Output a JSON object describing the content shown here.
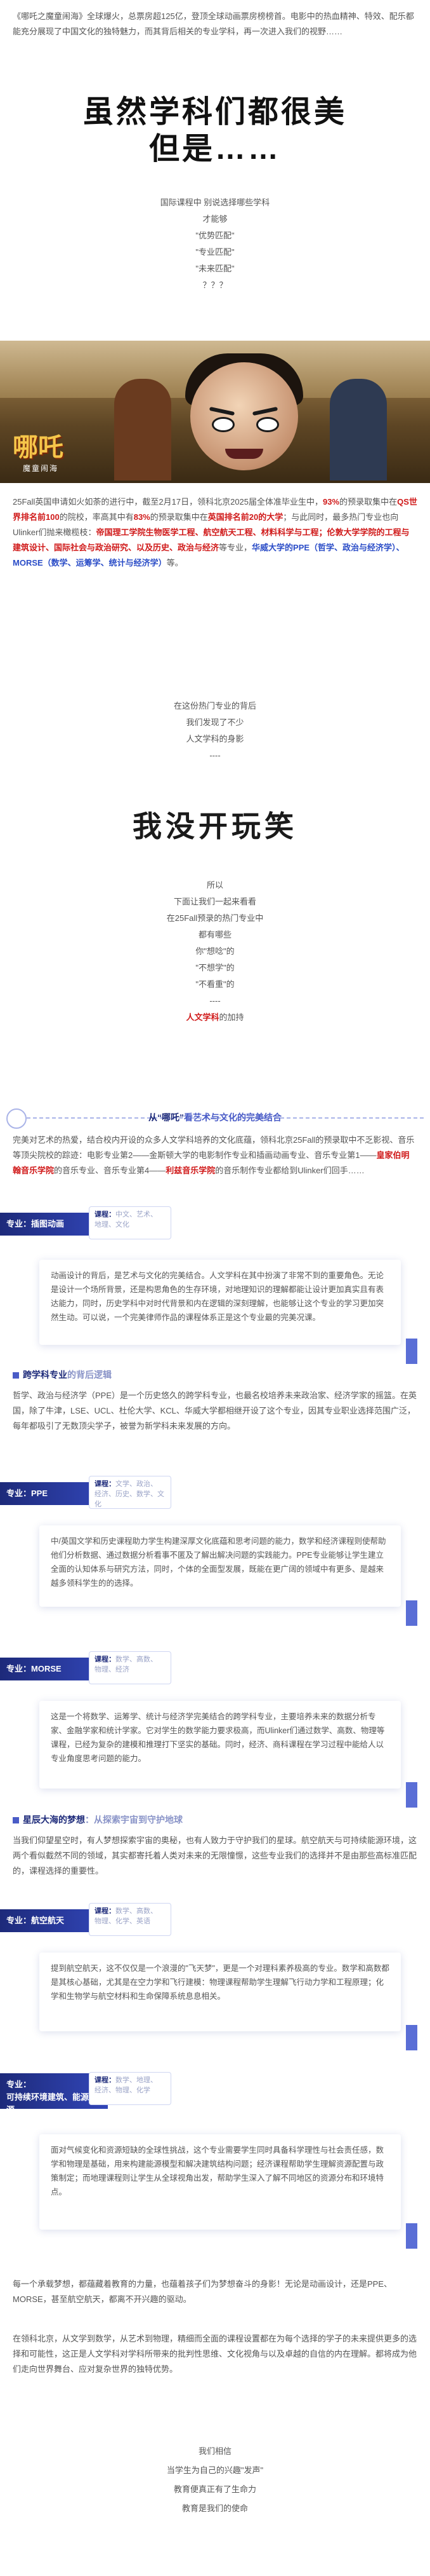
{
  "intro": {
    "line": "《哪吒之魔童闹海》全球爆火，总票房超125亿，登顶全球动画票房榜榜首。电影中的热血精神、特效、配乐都能充分展现了中国文化的独特魅力，而其背后相关的专业学科，再一次进入我们的视野……"
  },
  "hero": {
    "line1": "虽然学科们都很美",
    "line2": "但是……"
  },
  "pre_center": [
    "国际课程中 别说选择哪些学科",
    "才能够",
    "\"优势匹配\"",
    "\"专业匹配\"",
    "\"未来匹配\"",
    "？？？"
  ],
  "movie": {
    "logo": "哪吒",
    "logo_sub": "魔童闹海"
  },
  "fall": {
    "text_a": "25Fall英国申请如火如荼的进行中，截至2月17日，领科北京2025届全体准毕业生中，",
    "pct93": "93%",
    "text_b": "的预录取集中在",
    "qs100": "QS世界排名前100",
    "text_c": "的院校，率高其中有",
    "pct83": "83%",
    "text_d": "的预录取集中在",
    "uk_top20": "英国排名前20的大学",
    "text_e": "；与此同时，最多热门专业也向Ulinker们抛来橄榄枝：",
    "u1": "帝国理工学院生物医学工程、航空航天工程、材料科学与工程；伦敦大学学院的工程与建筑设计、国际社会与政治研究、以及历史、政治与经济",
    "text_f": "等专业，",
    "u2": "华威大学的PPE（哲学、政治与经济学）、MORSE（数学、运筹学、统计与经济学）",
    "text_g": "等。"
  },
  "mid_center": [
    "在这份热门专业的背后",
    "我们发现了不少",
    "人文学科的身影",
    "----"
  ],
  "joke": "我没开玩笑",
  "post_center": [
    "所以",
    "下面让我们一起来看看",
    "在25Fall预录的热门专业中",
    "都有哪些",
    "你\"想唸\"的",
    "\"不想学\"的",
    "\"不看重\"的",
    "----"
  ],
  "post_center_last": "人文学科",
  "post_center_last_tail": "的加持",
  "sec1": {
    "title_a": "从“哪吒”",
    "title_b": "看艺术与文化的完美结合",
    "body": "完美对艺术的热爱，结合校内开设的众多人文学科培养的文化底蕴，领科北京25Fall的预录取中不乏影视、音乐等顶尖院校的踪迹：电影专业第2——金斯顿大学的电影制作专业和插画动画专业、音乐专业第1——",
    "red_a": "皇家伯明翰音乐学院",
    "body_mid": "的音乐专业、音乐专业第4——",
    "red_b": "利兹音乐学院",
    "body_end": "的音乐制作专业都给到Ulinker们回手……"
  },
  "arts": {
    "tag": "专业：插图动画",
    "cat_lbl": "课程：",
    "cat_1": "中文、",
    "cat_2": "艺术、",
    "cat_3": "地理、文化",
    "card": "动画设计的背后，是艺术与文化的完美结合。人文学科在其中扮演了非常不到的重要角色。无论是设计一个场所背景，还是构思角色的生存环境，对地理知识的理解都能让设计更加真实且有表达能力，同时，历史学科中对时代背景和内在逻辑的深刻理解，也能够让这个专业的学习更加突然生动。可以说，一个完美律师作品的课程体系正是这个专业最的完美况课。"
  },
  "sec2": {
    "heading_a": "跨学科专业",
    "heading_b": "的背后逻辑",
    "body": "哲学、政治与经济学（PPE）是一个历史悠久的跨学科专业，也最名校培养未来政治家、经济学家的摇篮。在英国，除了牛津，LSE、UCL、杜伦大学、KCL、华威大学都相继开设了这个专业，因其专业职业选择范围广泛，每年都吸引了无数顶尖学子，被誉为新学科未来发展的方向。"
  },
  "ppe": {
    "tag": "专业：PPE",
    "cat_lbl": "课程：",
    "cat_1": "文学、",
    "cat_2": "政治、",
    "cat_3": "经济、历史、数学、文化",
    "card": "中/英国文学和历史课程助力学生构建深厚文化底蕴和思考问题的能力，数学和经济课程则使帮助他们分析数据、通过数据分析看事不匿及了解出解决问题的实践能力。PPE专业能够让学生建立全面的认知体系与研究方法，同时，个体的全面型发展，既能在更广阔的领域中有更多、是越来越多领科学生的的选择。"
  },
  "morse": {
    "tag": "专业：MORSE",
    "cat_lbl": "课程：",
    "cat_1": "数学、",
    "cat_2": "高数、",
    "cat_3": "物理、经济",
    "card": "这是一个将数学、运筹学、统计与经济学完美结合的跨学科专业，主要培养未来的数据分析专家、金融学家和统计学家。它对学生的数学能力要求极高，而Ulinker们通过数学、高数、物理等课程，已经为复杂的建模和推理打下坚实的基础。同时，经济、商科课程在学习过程中能给人以专业角度思考问题的能力。"
  },
  "sec3": {
    "heading_a": "星辰大海的梦想",
    "heading_b": "：从探索宇宙到守护地球",
    "body": "当我们仰望星空时，有人梦想探索宇宙的奥秘，也有人致力于守护我们的星球。航空航天与可持续能源环境，这两个看似截然不同的领域，其实都寄托着人类对未来的无限憧憬，这些专业我们的选择并不是由那些高标准匹配的，课程选择的重要性。"
  },
  "aero": {
    "tag": "专业：航空航天",
    "cat_lbl": "课程：",
    "cat_1": "数学、",
    "cat_2": "高数、",
    "cat_3": "物理、化学、英语",
    "card": "提到航空航天，这不仅仅是一个浪漫的\"飞天梦\"，更是一个对理科素养极高的专业。数学和高数都是其核心基础，尤其是在空力学和飞行建模：物理课程帮助学生理解飞行动力学和工程原理；化学和生物学与航空材料和生命保障系统息息相关。"
  },
  "sustain": {
    "tag_1": "专业：",
    "tag_2": "可持续环境建筑、能源与资源",
    "cat_lbl": "课程：",
    "cat_1": "数学、",
    "cat_2": "地理、",
    "cat_3": "经济、物理、化学",
    "card": "面对气候变化和资源短缺的全球性挑战，这个专业需要学生同时具备科学理性与社会责任感，数学和物理是基础，用来构建能源模型和解决建筑结构问题；经济课程帮助学生理解资源配置与政策制定；而地理课程则让学生从全球视角出发，帮助学生深入了解不同地区的资源分布和环境特点。"
  },
  "closing": {
    "p1": "每一个承载梦想，都蕴藏着教育的力量，也蕴着孩子们为梦想奋斗的身影！无论是动画设计，还是PPE、MORSE，甚至航空航天，都离不开兴趣的驱动。",
    "p2": "在领科北京，从文学到数学，从艺术到物理，精细而全面的课程设置都在为每个选择的学子的未来提供更多的选择和可能性，这正是人文学科对学科所带来的批判性思维、文化视角与以及卓越的自信的内在理解。都将成为他们走向世界舞台、应对复杂世界的独特优势。"
  },
  "final_center": [
    "我们相信",
    "当学生为自己的兴趣\"发声\"",
    "教育便真正有了生命力",
    "教育是我们的使命"
  ]
}
